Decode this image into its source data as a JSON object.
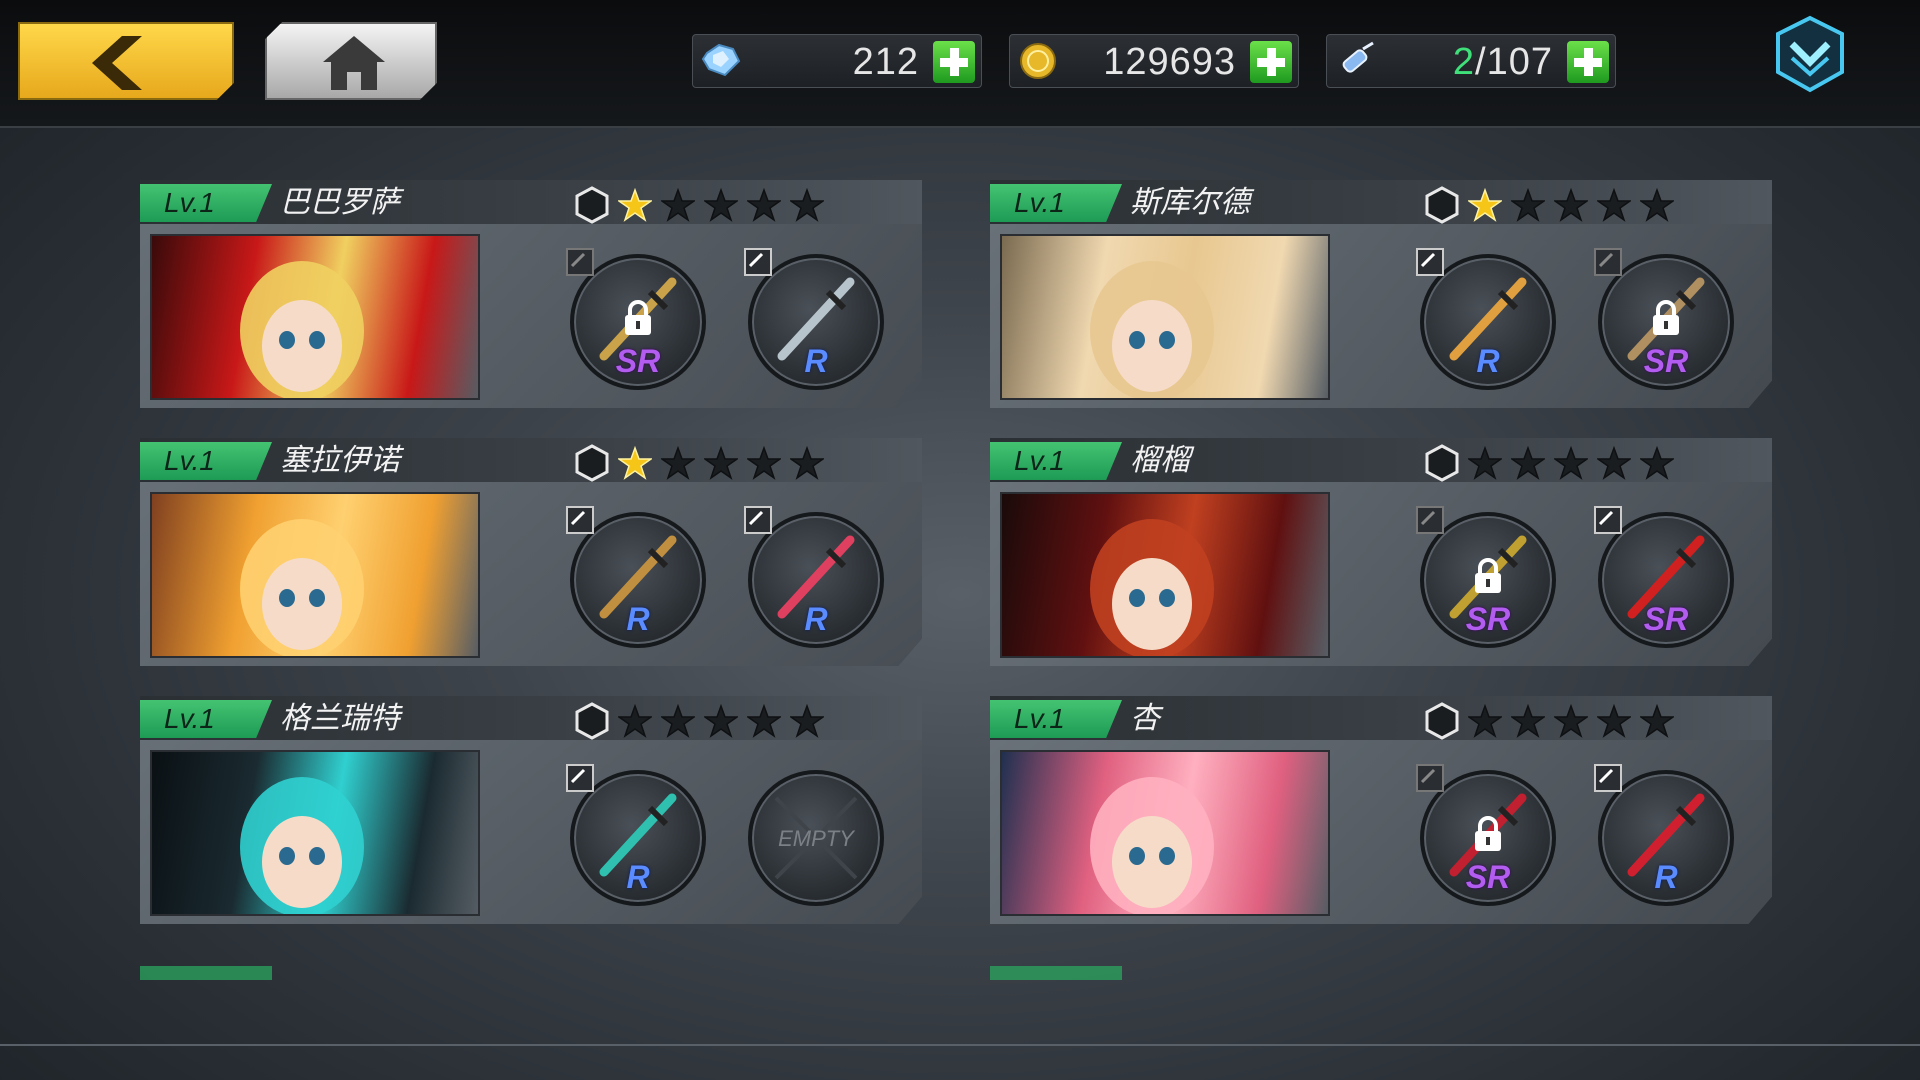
{
  "resources": {
    "gems": "212",
    "gold": "129693",
    "tickets_current": "2",
    "tickets_total": "/107"
  },
  "slot_labels": {
    "empty": "EMPTY",
    "sr": "SR",
    "r": "R"
  },
  "characters": [
    {
      "level": "Lv.1",
      "name": "巴巴罗萨",
      "stars_filled": 1,
      "stars_total": 5,
      "weapons": [
        {
          "rank": "SR",
          "locked": true,
          "edit_active": false,
          "color": "#c9a24a"
        },
        {
          "rank": "R",
          "locked": false,
          "edit_active": true,
          "color": "#b8c4cc"
        }
      ]
    },
    {
      "level": "Lv.1",
      "name": "斯库尔德",
      "stars_filled": 1,
      "stars_total": 5,
      "weapons": [
        {
          "rank": "R",
          "locked": false,
          "edit_active": true,
          "color": "#e0a040"
        },
        {
          "rank": "SR",
          "locked": true,
          "edit_active": false,
          "color": "#b09060"
        }
      ]
    },
    {
      "level": "Lv.1",
      "name": "塞拉伊诺",
      "stars_filled": 1,
      "stars_total": 5,
      "weapons": [
        {
          "rank": "R",
          "locked": false,
          "edit_active": true,
          "color": "#c09040"
        },
        {
          "rank": "R",
          "locked": false,
          "edit_active": true,
          "color": "#e04060"
        }
      ]
    },
    {
      "level": "Lv.1",
      "name": "榴榴",
      "stars_filled": 0,
      "stars_total": 5,
      "weapons": [
        {
          "rank": "SR",
          "locked": true,
          "edit_active": false,
          "color": "#c0a030"
        },
        {
          "rank": "SR",
          "locked": false,
          "edit_active": true,
          "color": "#d02020"
        }
      ]
    },
    {
      "level": "Lv.1",
      "name": "格兰瑞特",
      "stars_filled": 0,
      "stars_total": 5,
      "weapons": [
        {
          "rank": "R",
          "locked": false,
          "edit_active": true,
          "color": "#30c0b0"
        },
        {
          "rank": "",
          "locked": false,
          "edit_active": false,
          "empty": true,
          "color": "#555"
        }
      ]
    },
    {
      "level": "Lv.1",
      "name": "杏",
      "stars_filled": 0,
      "stars_total": 5,
      "weapons": [
        {
          "rank": "SR",
          "locked": true,
          "edit_active": false,
          "color": "#c02030"
        },
        {
          "rank": "R",
          "locked": false,
          "edit_active": true,
          "color": "#d02030"
        }
      ]
    }
  ],
  "colors": {
    "accent_green": "#3fe07a",
    "back_yellow": "#f5c22e",
    "star_gold": "#f5c518",
    "star_empty": "#1a1d20"
  },
  "icons": {
    "back": "chevron-left-icon",
    "home": "home-icon",
    "gem": "diamond-icon",
    "gold": "coin-icon",
    "ticket": "syringe-icon",
    "menu": "chevron-down-shield-icon"
  }
}
